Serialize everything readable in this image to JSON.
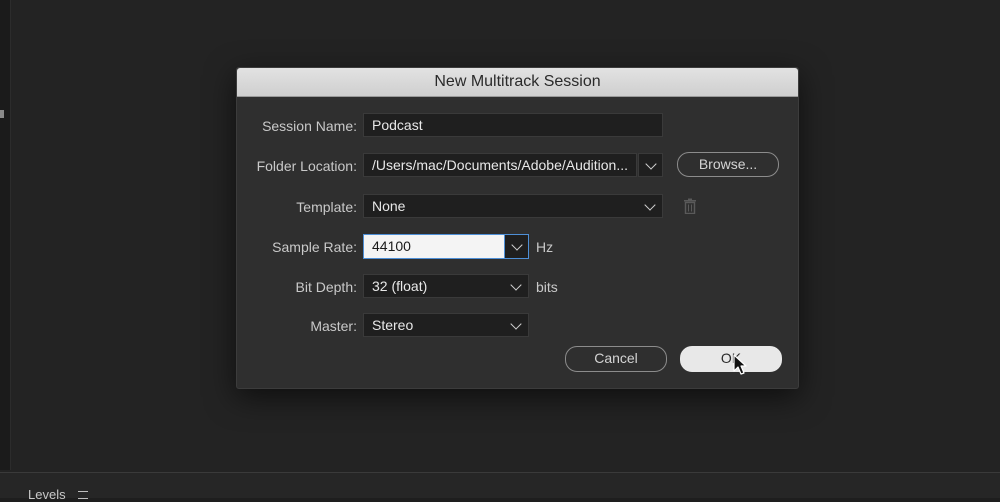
{
  "bottom_panel": {
    "title": "Levels"
  },
  "dialog": {
    "title": "New Multitrack Session",
    "session_name": {
      "label": "Session Name:",
      "value": "Podcast"
    },
    "folder_location": {
      "label": "Folder Location:",
      "value": "/Users/mac/Documents/Adobe/Audition...",
      "browse_label": "Browse..."
    },
    "template": {
      "label": "Template:",
      "value": "None"
    },
    "sample_rate": {
      "label": "Sample Rate:",
      "value": "44100",
      "unit": "Hz"
    },
    "bit_depth": {
      "label": "Bit Depth:",
      "value": "32 (float)",
      "unit": "bits"
    },
    "master": {
      "label": "Master:",
      "value": "Stereo"
    },
    "cancel_label": "Cancel",
    "ok_label": "OK"
  },
  "icons": {
    "dropdown": "chevron-down-icon",
    "delete_template": "trash-icon",
    "cursor": "mouse-pointer-icon",
    "panel_menu": "hamburger-menu-icon"
  }
}
